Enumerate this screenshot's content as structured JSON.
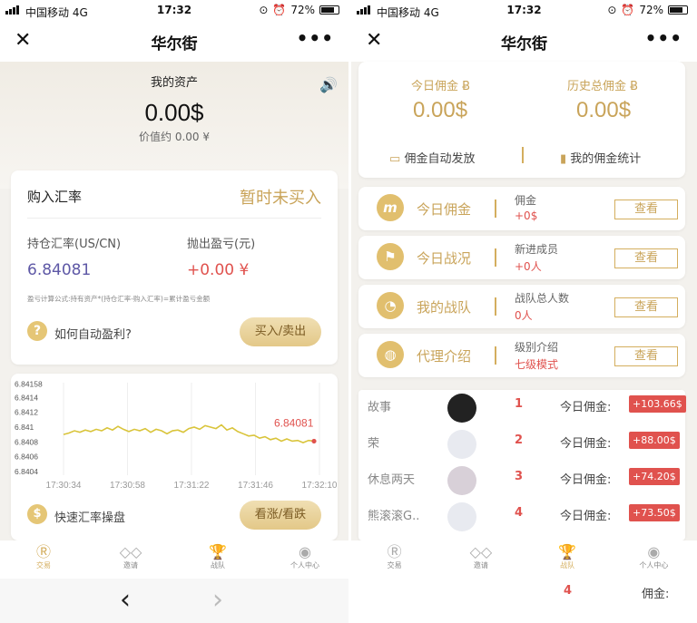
{
  "status": {
    "carrier": "中国移动",
    "network": "4G",
    "time": "17:32",
    "battery": "72%"
  },
  "navbar": {
    "title": "华尔街",
    "close": "✕",
    "more": "•••"
  },
  "left": {
    "assets": {
      "label": "我的资产",
      "value": "0.00$",
      "approx": "价值约 0.00 ¥"
    },
    "buy": {
      "title": "购入汇率",
      "status": "暂时未买入",
      "hold_label": "持仓汇率(US/CN)",
      "hold_value": "6.84081",
      "pnl_label": "抛出盈亏(元)",
      "pnl_value": "+0.00 ¥",
      "formula": "盈亏计算公式:持有资产*(持仓汇率-购入汇率)=累计盈亏金额",
      "help_text": "如何自动盈利?",
      "trade_btn": "买入/卖出"
    },
    "quick": {
      "label": "快速汇率操盘",
      "btn": "看涨/看跌"
    }
  },
  "chart_data": {
    "type": "line",
    "title": "",
    "ylim": [
      6.84035,
      6.8416
    ],
    "yticks": [
      "6.84158",
      "6.8414",
      "6.8412",
      "6.841",
      "6.8408",
      "6.84",
      "6.84"
    ],
    "yticks_full": [
      "6.84158",
      "6.8414",
      "6.8412",
      "6.841",
      "6.8408",
      "6.8406",
      "6.8404"
    ],
    "xticks": [
      "17:30:34",
      "17:30:58",
      "17:31:22",
      "17:31:46",
      "17:32:10"
    ],
    "last_label": "6.84081",
    "series": [
      {
        "values": [
          6.8409,
          6.84092,
          6.84095,
          6.84093,
          6.84096,
          6.84094,
          6.84097,
          6.84095,
          6.84099,
          6.84096,
          6.84101,
          6.84097,
          6.84094,
          6.84097,
          6.84095,
          6.84098,
          6.84093,
          6.84097,
          6.84095,
          6.84091,
          6.84095,
          6.84096,
          6.84093,
          6.84098,
          6.841,
          6.84097,
          6.84102,
          6.841,
          6.84098,
          6.84103,
          6.84096,
          6.84099,
          6.84094,
          6.84091,
          6.84088,
          6.84089,
          6.84085,
          6.84087,
          6.84083,
          6.84085,
          6.84081,
          6.84084,
          6.84081,
          6.84082,
          6.84079,
          6.84082,
          6.84081
        ]
      }
    ]
  },
  "right": {
    "top": {
      "today_label": "今日佣金",
      "today_value": "0.00$",
      "history_label": "历史总佣金",
      "history_value": "0.00$",
      "auto": "佣金自动发放",
      "stats": "我的佣金统计"
    },
    "rows": [
      {
        "title": "今日佣金",
        "sub": "佣金",
        "val": "+0$",
        "btn": "查看",
        "icon": "m-icon"
      },
      {
        "title": "今日战况",
        "sub": "新进成员",
        "val": "+0人",
        "btn": "查看",
        "icon": "runner-icon"
      },
      {
        "title": "我的战队",
        "sub": "战队总人数",
        "val": "0人",
        "btn": "查看",
        "icon": "pie-icon"
      },
      {
        "title": "代理介绍",
        "sub": "级别介绍",
        "val": "七级模式",
        "btn": "查看",
        "icon": "globe-icon"
      }
    ],
    "leaders": [
      {
        "name": "故事",
        "rank": "1",
        "label": "今日佣金:",
        "amount": "+103.66$"
      },
      {
        "name": "荣",
        "rank": "2",
        "label": "今日佣金:",
        "amount": "+88.00$"
      },
      {
        "name": "休息两天",
        "rank": "3",
        "label": "今日佣金:",
        "amount": "+74.20$"
      },
      {
        "name": "熊滚滚G..",
        "rank": "4",
        "label": "今日佣金:",
        "amount": "+73.50$"
      }
    ],
    "peek": {
      "rank": "4",
      "label": "佣金:"
    }
  },
  "tabs": [
    {
      "label": "交易"
    },
    {
      "label": "邀请"
    },
    {
      "label": "战队"
    },
    {
      "label": "个人中心"
    }
  ],
  "browser": {
    "back": "‹",
    "forward": "›"
  },
  "colors": {
    "gold": "#c9a45a",
    "red": "#e0524e",
    "purple": "#5e58a6",
    "chart_line": "#d9c43a"
  }
}
